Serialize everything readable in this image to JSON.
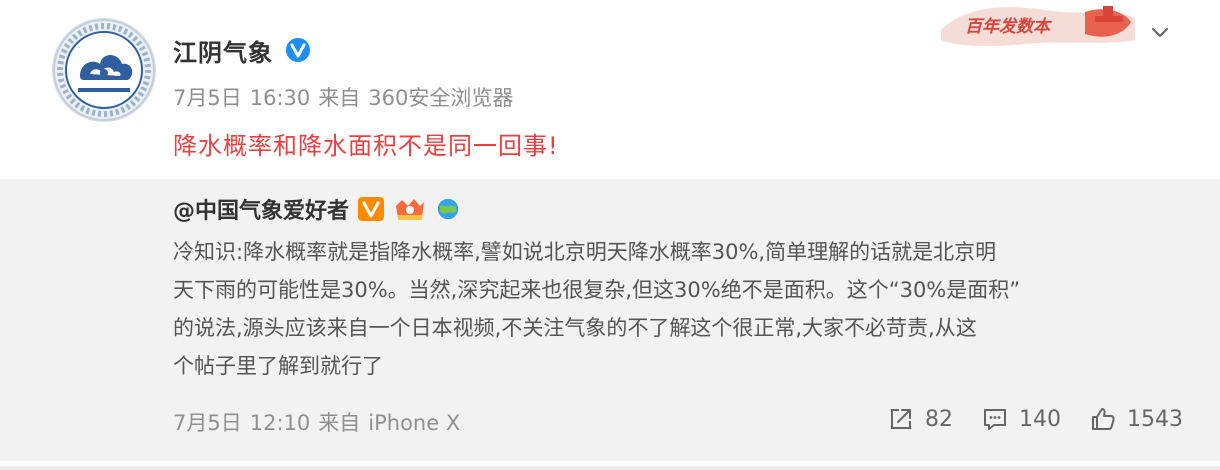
{
  "post": {
    "author": "江阴气象",
    "date": "7月5日",
    "time": "16:30",
    "source_prefix": "来自",
    "source": "360安全浏览器",
    "text": "降水概率和降水面积不是同一回事!",
    "colors": {
      "highlight_text": "#eb4040",
      "verified": "#1e8ef5",
      "repost_bg": "#f2f2f2"
    }
  },
  "banner": {
    "text": "百年发数本"
  },
  "repost": {
    "author": "@中国气象爱好者",
    "badges": [
      "v-badge-icon",
      "crown-badge-icon",
      "globe-badge-icon"
    ],
    "lines": [
      "冷知识:降水概率就是指降水概率,譬如说北京明天降水概率30%,简单理解的话就是北京明",
      "天下雨的可能性是30%。当然,深究起来也很复杂,但这30%绝不是面积。这个“30%是面积”",
      "的说法,源头应该来自一个日本视频,不关注气象的不了解这个很正常,大家不必苛责,从这",
      "个帖子里了解到就行了"
    ],
    "date": "7月5日",
    "time": "12:10",
    "source_prefix": "来自",
    "source": "iPhone X",
    "actions": {
      "repost_count": "82",
      "comment_count": "140",
      "like_count": "1543"
    }
  }
}
